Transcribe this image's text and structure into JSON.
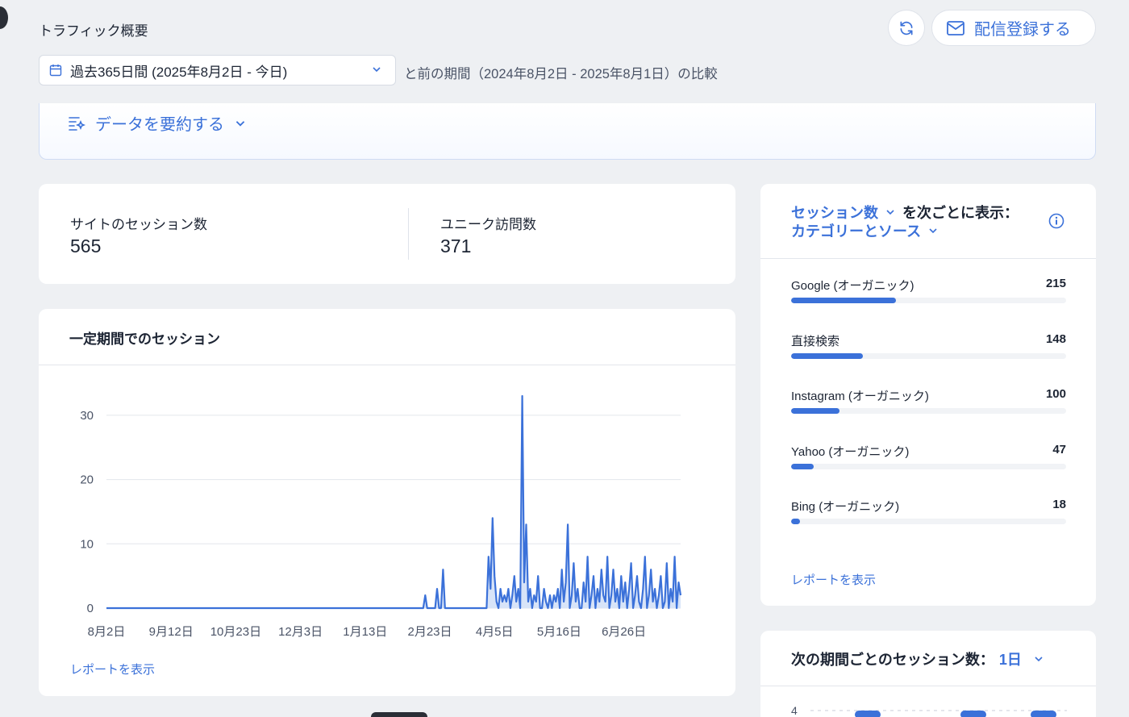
{
  "header": {
    "title": "トラフィック概要",
    "subscribe_label": "配信登録する",
    "date_range": "過去365日間 (2025年8月2日 - 今日)",
    "compare_text": "と前の期間（2024年8月2日 - 2025年8月1日）の比較"
  },
  "summary": {
    "label": "データを要約する"
  },
  "stats": [
    {
      "label": "サイトのセッション数",
      "value": "565"
    },
    {
      "label": "ユニーク訪問数",
      "value": "371"
    }
  ],
  "sessions_chart": {
    "title": "一定期間でのセッション",
    "link": "レポートを表示"
  },
  "chart_data": {
    "type": "area",
    "title": "一定期間でのセッション",
    "xlabel": "",
    "ylabel": "",
    "ylim": [
      0,
      33
    ],
    "yticks": [
      0,
      10,
      20,
      30
    ],
    "xtick_labels": [
      "8月2日",
      "9月12日",
      "10月23日",
      "12月3日",
      "1月13日",
      "2月23日",
      "4月5日",
      "5月16日",
      "6月26日"
    ],
    "grid": true,
    "color": "#3b71d9",
    "fill": "#d8e4f8",
    "series": [
      {
        "values": [
          0,
          0,
          0,
          0,
          0,
          0,
          0,
          0,
          0,
          0,
          0,
          0,
          0,
          0,
          0,
          0,
          0,
          0,
          0,
          0,
          0,
          0,
          0,
          0,
          0,
          0,
          0,
          0,
          0,
          0,
          0,
          0,
          0,
          0,
          0,
          0,
          0,
          0,
          0,
          0,
          0,
          0,
          0,
          0,
          0,
          0,
          0,
          0,
          0,
          0,
          0,
          0,
          0,
          0,
          0,
          0,
          0,
          0,
          0,
          0,
          0,
          0,
          0,
          0,
          0,
          0,
          0,
          0,
          0,
          0,
          0,
          0,
          0,
          0,
          0,
          0,
          0,
          0,
          0,
          0,
          0,
          0,
          0,
          0,
          0,
          0,
          0,
          0,
          0,
          0,
          0,
          0,
          0,
          0,
          0,
          0,
          0,
          0,
          0,
          0,
          0,
          0,
          0,
          0,
          0,
          0,
          0,
          0,
          0,
          0,
          0,
          0,
          0,
          0,
          0,
          0,
          0,
          0,
          0,
          0,
          0,
          0,
          0,
          0,
          0,
          0,
          0,
          0,
          0,
          0,
          0,
          0,
          0,
          0,
          0,
          0,
          0,
          0,
          0,
          0,
          0,
          0,
          0,
          0,
          0,
          0,
          0,
          0,
          0,
          0,
          0,
          0,
          0,
          0,
          0,
          0,
          0,
          0,
          0,
          0,
          0,
          2,
          0,
          0,
          0,
          0,
          0,
          3,
          0,
          0,
          6,
          0,
          0,
          0,
          0,
          0,
          0,
          0,
          0,
          0,
          0,
          0,
          0,
          0,
          0,
          0,
          0,
          0,
          0,
          0,
          0,
          0,
          0,
          8,
          3,
          14,
          5,
          1,
          0,
          3,
          1,
          2,
          1,
          3,
          0,
          2,
          5,
          1,
          3,
          0,
          33,
          4,
          13,
          1,
          3,
          0,
          2,
          1,
          5,
          0,
          0,
          3,
          1,
          0,
          2,
          0,
          2,
          1,
          3,
          0,
          6,
          1,
          4,
          13,
          0,
          2,
          7,
          1,
          3,
          0,
          0,
          4,
          1,
          8,
          0,
          2,
          5,
          0,
          3,
          1,
          6,
          2,
          1,
          8,
          0,
          2,
          6,
          1,
          3,
          0,
          5,
          1,
          4,
          0,
          3,
          7,
          0,
          2,
          5,
          1,
          0,
          3,
          8,
          0,
          2,
          6,
          1,
          3,
          0,
          2,
          5,
          0,
          1,
          7,
          0,
          3,
          1,
          8,
          0,
          4,
          2
        ]
      }
    ]
  },
  "sources": {
    "metric_label": "セッション数",
    "connector": "を次ごとに表示：",
    "dimension_label": "カテゴリーとソース",
    "items": [
      {
        "label": "Google (オーガニック)",
        "value": 215
      },
      {
        "label": "直接検索",
        "value": 148
      },
      {
        "label": "Instagram (オーガニック)",
        "value": 100
      },
      {
        "label": "Yahoo (オーガニック)",
        "value": 47
      },
      {
        "label": "Bing (オーガニック)",
        "value": 18
      }
    ],
    "max": 565,
    "link": "レポートを表示"
  },
  "next_period": {
    "title": "次の期間ごとのセッション数：",
    "value": "1日",
    "ytick": "4"
  }
}
